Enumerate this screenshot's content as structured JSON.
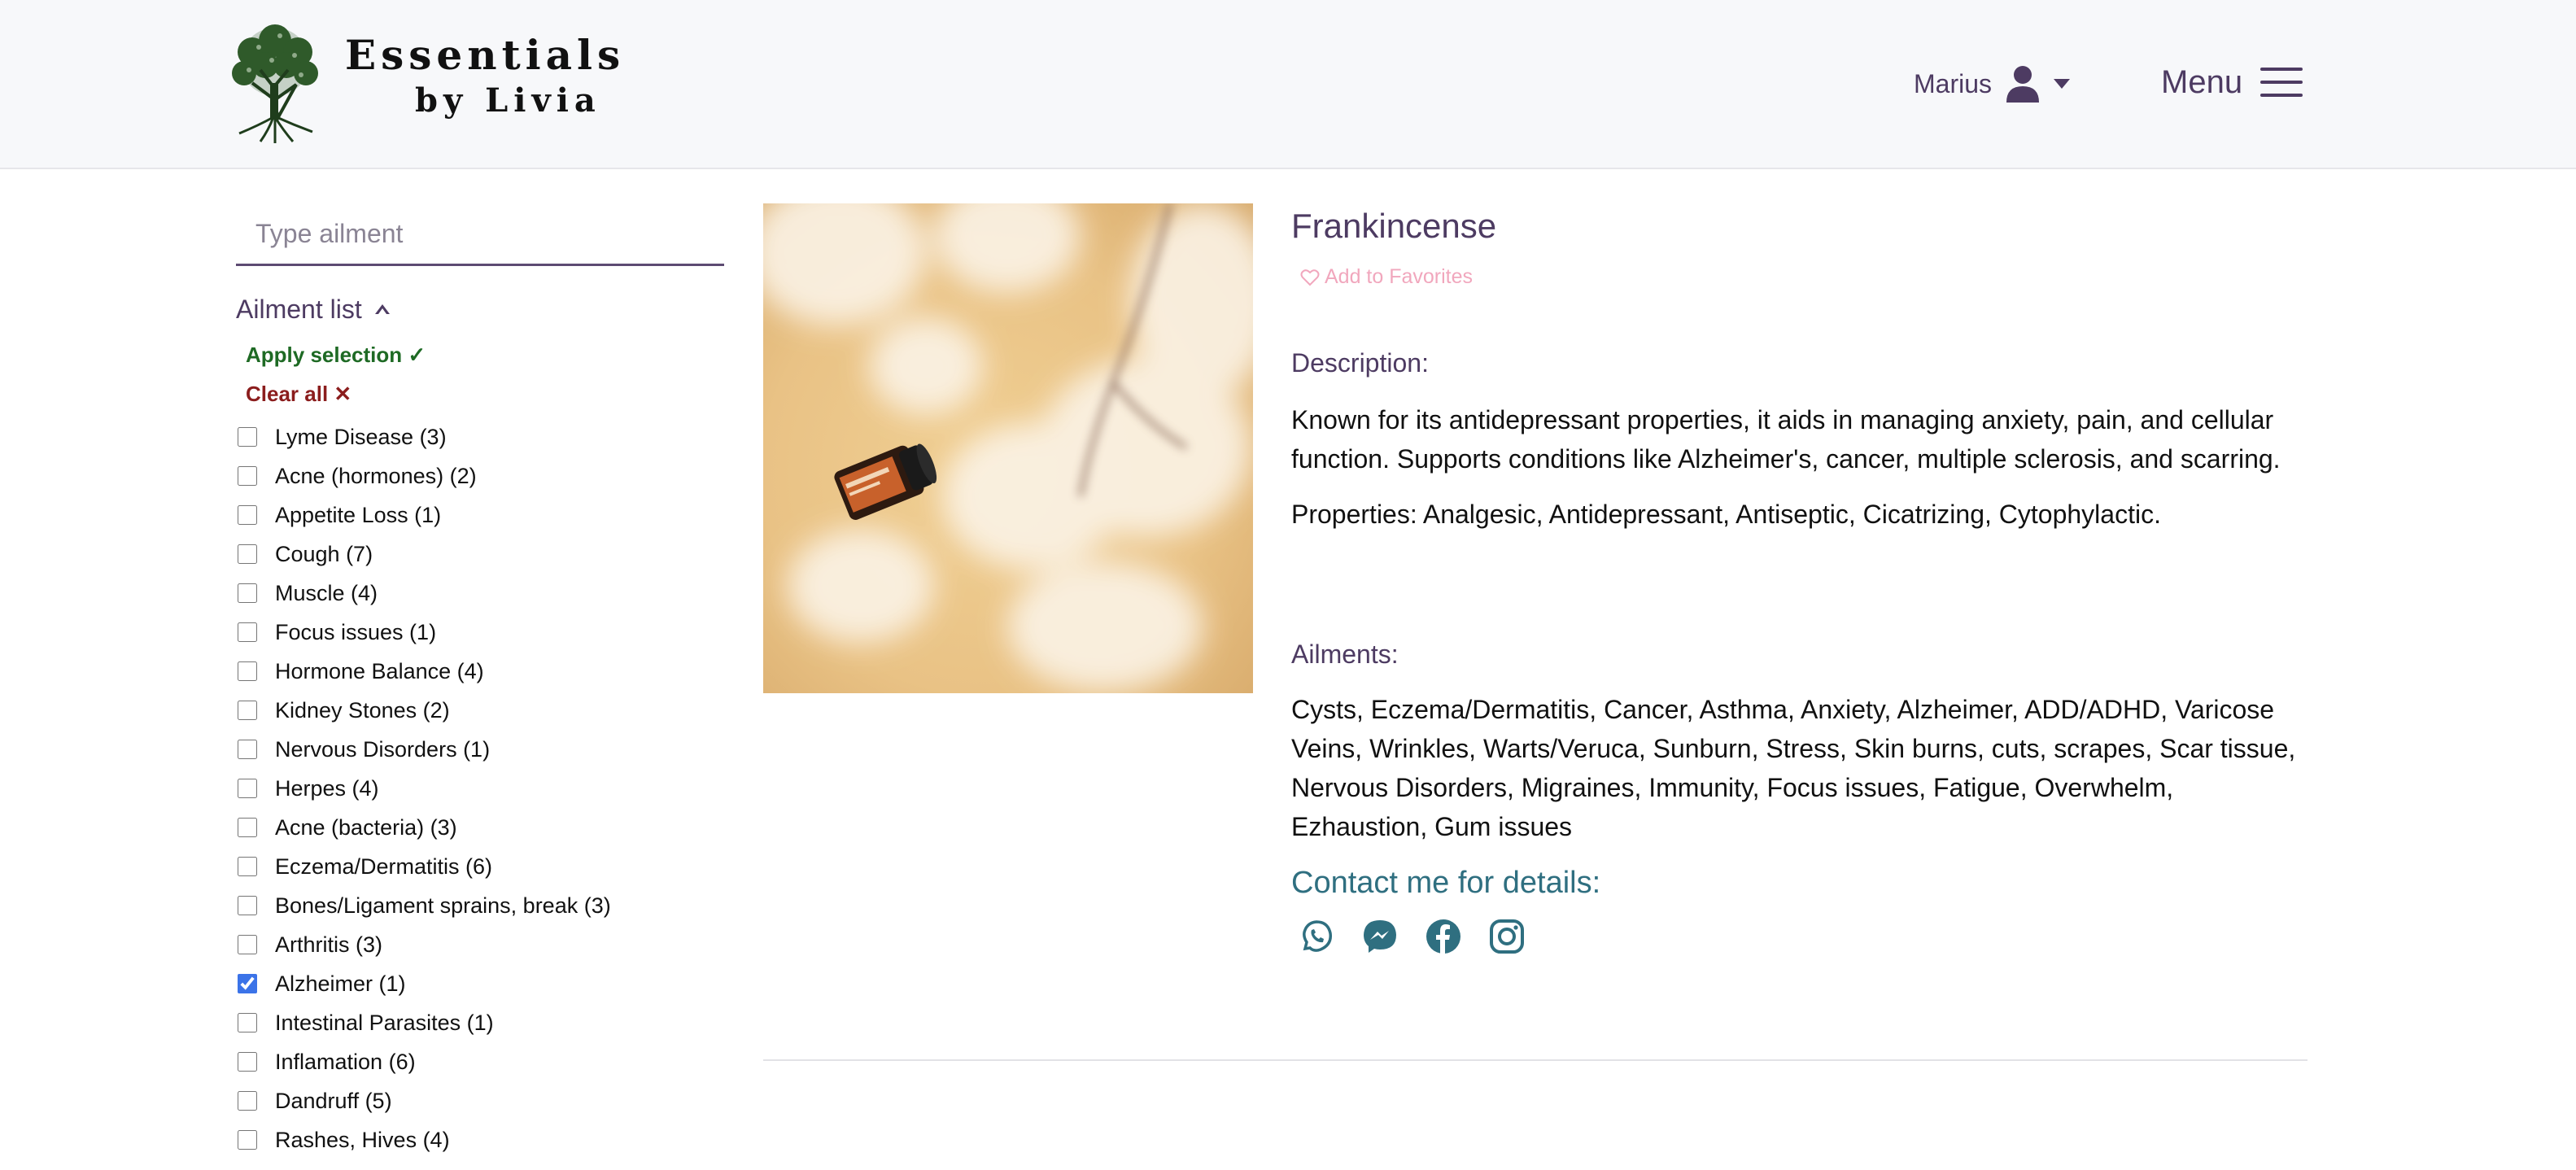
{
  "brand": {
    "line1": "Essentials",
    "line2": "by Livia"
  },
  "header": {
    "user_name": "Marius",
    "menu_label": "Menu"
  },
  "colors": {
    "accent": "#4d3b62",
    "apply": "#1e6a24",
    "clear": "#8b1d1d",
    "contact": "#2f6f80",
    "favorite": "#f1a7bd"
  },
  "sidebar": {
    "search": {
      "placeholder": "Type ailment",
      "value": ""
    },
    "list_title": "Ailment list",
    "apply_label": "Apply selection ✓",
    "clear_label": "Clear all ✕",
    "items": [
      {
        "label": "Lyme Disease (3)",
        "checked": false
      },
      {
        "label": "Acne (hormones) (2)",
        "checked": false
      },
      {
        "label": "Appetite Loss (1)",
        "checked": false
      },
      {
        "label": "Cough (7)",
        "checked": false
      },
      {
        "label": "Muscle (4)",
        "checked": false
      },
      {
        "label": "Focus issues (1)",
        "checked": false
      },
      {
        "label": "Hormone Balance (4)",
        "checked": false
      },
      {
        "label": "Kidney Stones (2)",
        "checked": false
      },
      {
        "label": "Nervous Disorders (1)",
        "checked": false
      },
      {
        "label": "Herpes (4)",
        "checked": false
      },
      {
        "label": "Acne (bacteria) (3)",
        "checked": false
      },
      {
        "label": "Eczema/Dermatitis (6)",
        "checked": false
      },
      {
        "label": "Bones/Ligament sprains, break (3)",
        "checked": false
      },
      {
        "label": "Arthritis (3)",
        "checked": false
      },
      {
        "label": "Alzheimer (1)",
        "checked": true
      },
      {
        "label": "Intestinal Parasites (1)",
        "checked": false
      },
      {
        "label": "Inflamation (6)",
        "checked": false
      },
      {
        "label": "Dandruff (5)",
        "checked": false
      },
      {
        "label": "Rashes, Hives (4)",
        "checked": false
      }
    ]
  },
  "product": {
    "title": "Frankincense",
    "favorite_label": "Add to Favorites",
    "description_label": "Description:",
    "description": "Known for its antidepressant properties, it aids in managing anxiety, pain, and cellular function. Supports conditions like Alzheimer's, cancer, multiple sclerosis, and scarring.",
    "properties": "Properties: Analgesic, Antidepressant, Antiseptic, Cicatrizing, Cytophylactic.",
    "ailments_label": "Ailments:",
    "ailments": "Cysts, Eczema/Dermatitis, Cancer, Asthma, Anxiety, Alzheimer, ADD/ADHD, Varicose Veins, Wrinkles, Warts/Veruca, Sunburn, Stress, Skin burns, cuts, scrapes, Scar tissue, Nervous Disorders, Migraines, Immunity, Focus issues, Fatigue, Overwhelm, Ezhaustion, Gum issues",
    "bottle_label": "Frankincense",
    "contact_label": "Contact me for details:",
    "social_icons": [
      "whatsapp-icon",
      "messenger-icon",
      "facebook-icon",
      "instagram-icon"
    ]
  }
}
